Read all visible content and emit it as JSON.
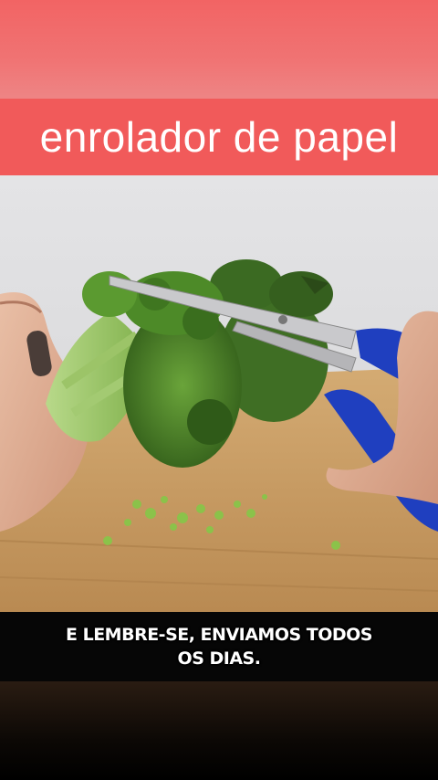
{
  "banner": {
    "title": "enrolador de papel"
  },
  "subtitle": {
    "line1": "E lembre-se, enviamos todos",
    "line2": "os dias."
  },
  "colors": {
    "banner_red": "#f15a5a",
    "scissor_handle": "#1f3fbf",
    "broccoli_green": "#4f8a2a",
    "board_wood": "#c9a068"
  }
}
